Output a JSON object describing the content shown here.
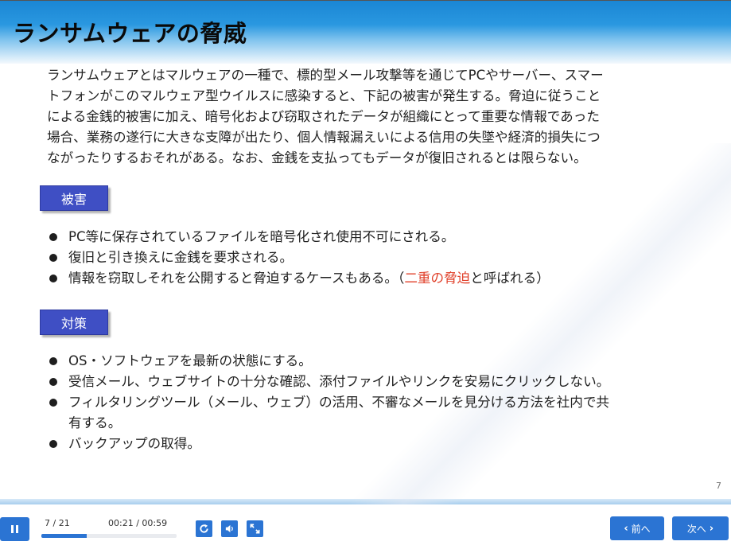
{
  "slide": {
    "title": "ランサムウェアの脅威",
    "intro_lines": [
      "ランサムウェアとはマルウェアの一種で、標的型メール攻撃等を通じてPCやサーバー、スマー",
      "トフォンがこのマルウェア型ウイルスに感染すると、下記の被害が発生する。脅迫に従うこと",
      "による金銭的被害に加え、暗号化および窃取されたデータが組織にとって重要な情報であった",
      "場合、業務の遂行に大きな支障が出たり、個人情報漏えいによる信用の失墜や経済的損失につ",
      "ながったりするおそれがある。なお、金銭を支払ってもデータが復旧されるとは限らない。"
    ],
    "damage": {
      "label": "被害",
      "items": [
        "PC等に保存されているファイルを暗号化され使用不可にされる。",
        "復旧と引き換えに金銭を要求される。"
      ],
      "item3_before": "情報を窃取しそれを公開すると脅迫するケースもある。（",
      "item3_highlight": "二重の脅迫",
      "item3_after": "と呼ばれる）"
    },
    "measures": {
      "label": "対策",
      "items": [
        "OS・ソフトウェアを最新の状態にする。",
        "受信メール、ウェブサイトの十分な確認、添付ファイルやリンクを安易にクリックしない。"
      ],
      "item3_line1": "フィルタリングツール（メール、ウェブ）の活用、不審なメールを見分ける方法を社内で共",
      "item3_line2": "有する。",
      "item4": "バックアップの取得。"
    },
    "page_number": "7"
  },
  "player": {
    "counter": "7 / 21",
    "timer": "00:21 / 00:59",
    "progress_fraction": 0.333,
    "prev_label": "前へ",
    "next_label": "次へ",
    "icons": {
      "pause": "pause-icon",
      "replay": "replay-icon",
      "volume": "volume-icon",
      "fullscreen": "fullscreen-icon"
    },
    "colors": {
      "accent": "#2b74d3",
      "label_bg": "#3f4fc4",
      "highlight": "#e0402a"
    }
  }
}
